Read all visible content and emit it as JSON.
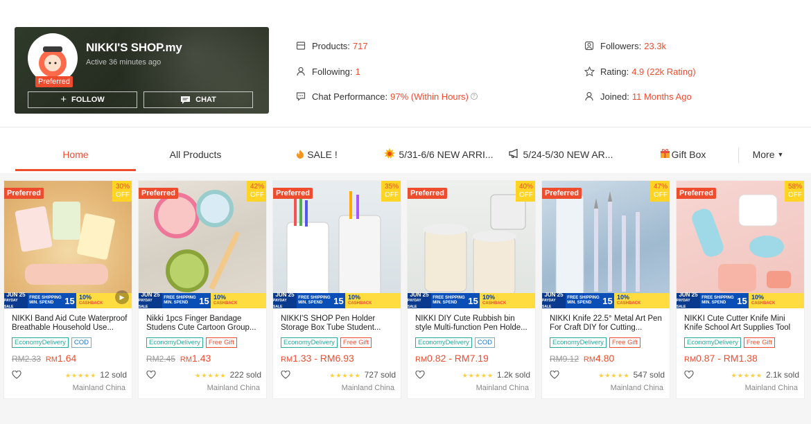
{
  "shop": {
    "name": "NIKKI'S SHOP.my",
    "active": "Active 36 minutes ago",
    "preferred_badge": "Preferred",
    "follow_label": "FOLLOW",
    "chat_label": "CHAT"
  },
  "stats": {
    "products_label": "Products:",
    "products_value": "717",
    "following_label": "Following:",
    "following_value": "1",
    "chat_perf_label": "Chat Performance:",
    "chat_perf_value": "97% (Within Hours)",
    "followers_label": "Followers:",
    "followers_value": "23.3k",
    "rating_label": "Rating:",
    "rating_value": "4.9 (22k Rating)",
    "joined_label": "Joined:",
    "joined_value": "11 Months Ago"
  },
  "tabs": [
    {
      "label": "Home"
    },
    {
      "label": "All Products"
    },
    {
      "label": "SALE !"
    },
    {
      "label": "5/31-6/6 NEW ARRI..."
    },
    {
      "label": "5/24-5/30 NEW AR..."
    },
    {
      "label": "Gift Box"
    },
    {
      "label": "More"
    }
  ],
  "banner": {
    "date": "JUN 25",
    "sale": "PAYDAY SALE",
    "free": "FREE SHIPPING",
    "min": "MIN. SPEND",
    "num": "15",
    "pct": "10%",
    "cashback": "CASHBACK"
  },
  "colors": {
    "accent": "#ee4d2d",
    "tag_green": "#26aa99",
    "star": "#ffce3d"
  },
  "products": [
    {
      "preferred": "Preferred",
      "off_pct": "30%",
      "off": "OFF",
      "title": "NIKKI Band Aid Cute Waterproof Breathable Household Use...",
      "tags": [
        "EconomyDelivery",
        "COD"
      ],
      "old_price": "RM2.33",
      "price_prefix": "RM",
      "price": "1.64",
      "price_to": "",
      "sold": "12 sold",
      "location": "Mainland China",
      "video": true
    },
    {
      "preferred": "Preferred",
      "off_pct": "42%",
      "off": "OFF",
      "title": "Nikki 1pcs Finger Bandage Studens Cute Cartoon Group...",
      "tags": [
        "EconomyDelivery",
        "Free Gift"
      ],
      "old_price": "RM2.45",
      "price_prefix": "RM",
      "price": "1.43",
      "price_to": "",
      "sold": "222 sold",
      "location": "Mainland China",
      "video": false
    },
    {
      "preferred": "Preferred",
      "off_pct": "35%",
      "off": "OFF",
      "title": "NIKKI'S SHOP Pen Holder Storage Box Tube Student...",
      "tags": [
        "EconomyDelivery",
        "Free Gift"
      ],
      "old_price": "",
      "price_prefix": "RM",
      "price": "1.33",
      "price_to": " - RM6.93",
      "sold": "727 sold",
      "location": "Mainland China",
      "video": false
    },
    {
      "preferred": "Preferred",
      "off_pct": "40%",
      "off": "OFF",
      "title": "NIKKI DIY Cute Rubbish bin style Multi-function Pen Holde...",
      "tags": [
        "EconomyDelivery",
        "COD"
      ],
      "old_price": "",
      "price_prefix": "RM",
      "price": "0.82",
      "price_to": " - RM7.19",
      "sold": "1.2k sold",
      "location": "Mainland China",
      "video": false
    },
    {
      "preferred": "Preferred",
      "off_pct": "47%",
      "off": "OFF",
      "title": "NIKKI Knife 22.5° Metal Art Pen For Craft DIY for Cutting...",
      "tags": [
        "EconomyDelivery",
        "Free Gift"
      ],
      "old_price": "RM9.12",
      "price_prefix": "RM",
      "price": "4.80",
      "price_to": "",
      "sold": "547 sold",
      "location": "Mainland China",
      "video": false
    },
    {
      "preferred": "Preferred",
      "off_pct": "58%",
      "off": "OFF",
      "title": "NIKKI Cute Cutter Knife Mini Knife School Art Supplies Tool",
      "tags": [
        "EconomyDelivery",
        "Free Gift"
      ],
      "old_price": "",
      "price_prefix": "RM",
      "price": "0.87",
      "price_to": " - RM1.38",
      "sold": "2.1k sold",
      "location": "Mainland China",
      "video": false
    }
  ]
}
